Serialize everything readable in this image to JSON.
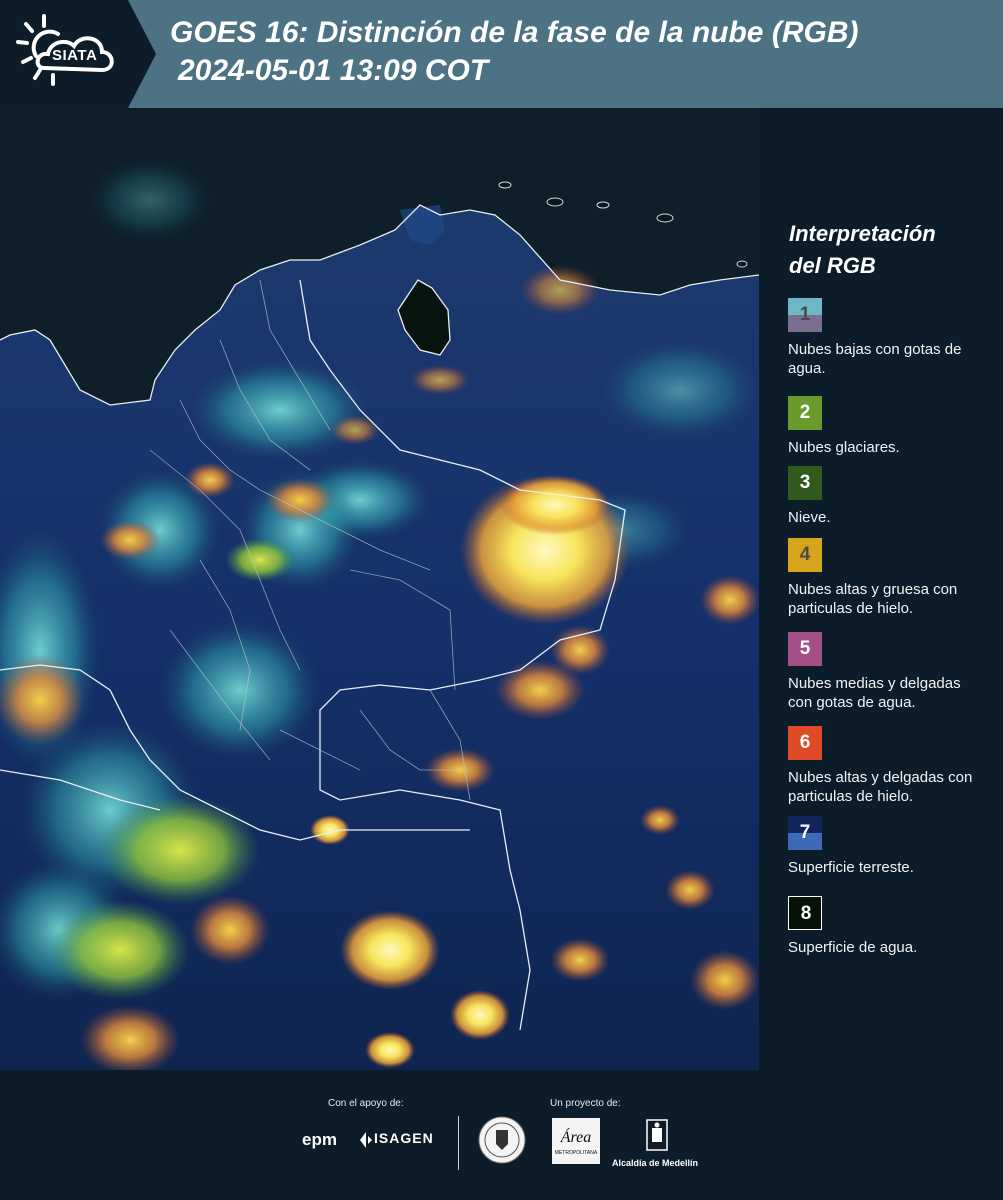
{
  "header": {
    "logo_text": "SIATA",
    "title_line1": "GOES 16: Distinción de la fase de la nube (RGB)",
    "title_line2": "2024-05-01 13:09 COT"
  },
  "legend": {
    "title_line1": "Interpretación",
    "title_line2": "del RGB",
    "items": [
      {
        "number": "1",
        "label": "Nubes bajas con gotas de agua.",
        "color_top": "#6db7c6",
        "color_bottom": "#7c6e8e"
      },
      {
        "number": "2",
        "label": "Nubes glaciares.",
        "color_top": "#6a9a2c",
        "color_bottom": "#6a9a2c"
      },
      {
        "number": "3",
        "label": "Nieve.",
        "color_top": "#335a1e",
        "color_bottom": "#335a1e"
      },
      {
        "number": "4",
        "label": "Nubes altas y gruesa con particulas de hielo.",
        "color_top": "#d6a51c",
        "color_bottom": "#d6a51c"
      },
      {
        "number": "5",
        "label": "Nubes medias y delgadas con gotas de agua.",
        "color_top": "#a44f86",
        "color_bottom": "#a44f86"
      },
      {
        "number": "6",
        "label": "Nubes altas y delgadas con particulas de hielo.",
        "color_top": "#e04a26",
        "color_bottom": "#e04a26"
      },
      {
        "number": "7",
        "label": "Superficie terreste.",
        "color_top": "#13245e",
        "color_bottom": "#3e68b8"
      },
      {
        "number": "8",
        "label": "Superficie de agua.",
        "color_top": "#06110a",
        "color_bottom": "#06110a"
      }
    ]
  },
  "footer": {
    "support_label": "Con el apoyo de:",
    "project_label": "Un proyecto de:",
    "epm": "epm",
    "isagen": "ISAGEN",
    "area_text": "Área",
    "area_sub": "METROPOLITANA",
    "alcaldia": "Alcaldía de Medellín"
  },
  "colors": {
    "header_bg": "#4c7283",
    "page_bg": "#0c1c28"
  }
}
